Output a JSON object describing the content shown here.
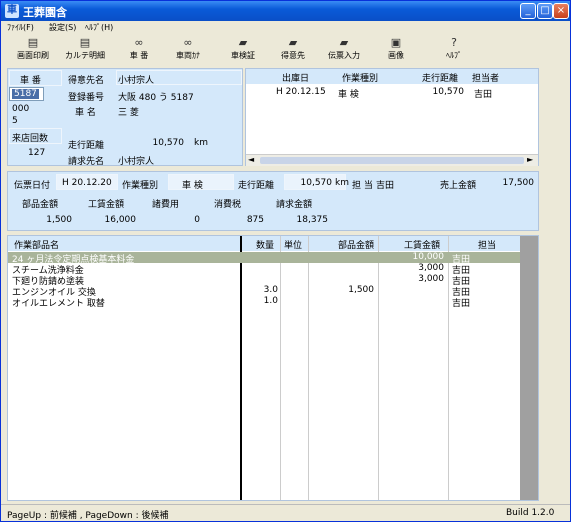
{
  "window": {
    "title": "王葬園含",
    "icon": "app-icon"
  },
  "menu": {
    "file": "ﾌｧｲﾙ(F)",
    "settings": "設定(S)",
    "help": "ﾍﾙﾌﾟ(H)"
  },
  "toolbar": [
    {
      "label": "画面印刷",
      "icon": "printer-icon"
    },
    {
      "label": "カルテ明細",
      "icon": "printer-icon"
    },
    {
      "label": "車 番",
      "icon": "binoculars-icon"
    },
    {
      "label": "車両ｶﾅ",
      "icon": "binoculars-icon"
    },
    {
      "label": "車検証",
      "icon": "folder-icon"
    },
    {
      "label": "得意先",
      "icon": "folder-icon"
    },
    {
      "label": "伝票入力",
      "icon": "folder-icon"
    },
    {
      "label": "画像",
      "icon": "image-icon"
    },
    {
      "label": "ﾍﾙﾌﾟ",
      "icon": "help-icon"
    }
  ],
  "vehicle": {
    "car_no_label": "車 番",
    "car_no": "5187",
    "code1": "000",
    "code2": "5",
    "visits_label": "来店回数",
    "visits": "127",
    "customer_label": "得意先名",
    "customer": "小村宗人",
    "reg_label": "登録番号",
    "reg": "大阪 480 う 5187",
    "maker_label": "車 名",
    "maker": "三 菱",
    "mileage_label": "走行距離",
    "mileage": "10,570",
    "mileage_unit": "km",
    "billing_label": "請求先名",
    "billing": "小村宗人"
  },
  "history": {
    "headers": [
      "出庫日",
      "作業種別",
      "走行距離",
      "担当者"
    ],
    "rows": [
      [
        "H 20.12.15",
        "車 検",
        "10,570",
        "吉田"
      ]
    ]
  },
  "slip": {
    "date_label": "伝票日付",
    "date": "H 20.12.20",
    "type_label": "作業種別",
    "type": "車 検",
    "mileage_label": "走行距離",
    "mileage": "10,570",
    "mileage_unit": "km",
    "staff_label": "担 当",
    "staff": "吉田",
    "sales_label": "売上金額",
    "sales": "17,500"
  },
  "totals": {
    "headers": [
      "部品金額",
      "工賃金額",
      "諸費用",
      "消費税",
      "請求金額"
    ],
    "values": [
      "1,500",
      "16,000",
      "0",
      "875",
      "18,375"
    ]
  },
  "items": {
    "headers": [
      "作業部品名",
      "数量",
      "単位",
      "部品金額",
      "工賃金額",
      "担当"
    ],
    "rows": [
      [
        "24 ヶ月法令定期点検基本料金",
        "",
        "",
        "",
        "10,000",
        "吉田"
      ],
      [
        "スチーム洗浄料金",
        "",
        "",
        "",
        "3,000",
        "吉田"
      ],
      [
        "下廻り防錆め塗装",
        "",
        "",
        "",
        "3,000",
        "吉田"
      ],
      [
        "エンジンオイル 交換",
        "3.0",
        "",
        "1,500",
        "",
        "吉田"
      ],
      [
        "オイルエレメント 取替",
        "1.0",
        "",
        "",
        "",
        "吉田"
      ]
    ]
  },
  "status": {
    "hint": "PageUp : 前候補 , PageDown : 後候補",
    "build": "Build 1.2.0"
  }
}
